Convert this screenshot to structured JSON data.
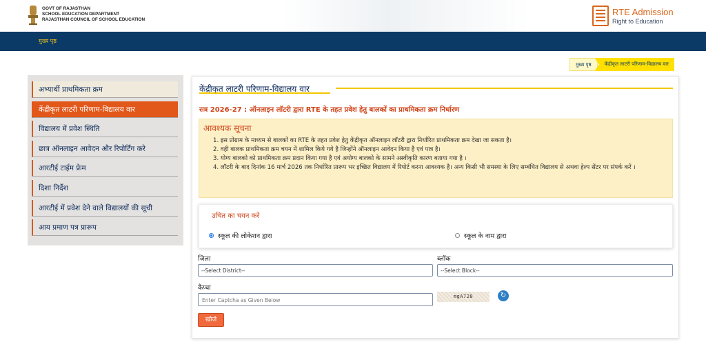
{
  "header": {
    "govt_lines": [
      "GOVT OF RAJASTHAN",
      "SCHOOL EDUCATION DEPARTMENT",
      "RAJASTHAN COUNCIL OF SCHOOL EDUCATION"
    ],
    "rte_title": "RTE Admission",
    "rte_subtitle": "Right to Education"
  },
  "nav": {
    "home": "मुख्य पृष्ठ"
  },
  "breadcrumb": {
    "home": "मुख्य पृष्ठ",
    "current": "केंद्रीकृत लाटरी परिणाम-विद्यालय वार"
  },
  "sidebar": {
    "items": [
      {
        "label": "अभ्यार्थी प्राथमिकता क्रम"
      },
      {
        "label": "केंद्रीकृत लाटरी परिणाम-विद्यालय वार"
      },
      {
        "label": "विद्यालय में प्रवेश स्थिति"
      },
      {
        "label": "छात्र ऑनलाइन आवेदन और रिपोर्टिंग करे"
      },
      {
        "label": "आरटीई टाईम फ्रेम"
      },
      {
        "label": "दिशा निर्देश"
      },
      {
        "label": "आरटीई में प्रवेश देने वाले विद्यालयों की सूची"
      },
      {
        "label": "आय प्रमाण पत्र प्रारूप"
      }
    ]
  },
  "main": {
    "title": "केंद्रीकृत लाटरी परिणाम-विद्यालय वार",
    "session": "सत्र 2026-27 : ऑनलाइन लॉटरी द्वारा RTE के तहत प्रवेश हेतु बालकों का प्राथमिकता क्रम निर्धारण",
    "notice": {
      "title": "आवश्यक सूचना",
      "items": [
        "1. इस प्रोग्राम के माध्यम से बालकों का RTE के तहत प्रवेश हेतु केंद्रीकृत ऑनलाइन लॉटरी द्वारा निर्धारित प्राथमिकता क्रम देखा जा सकता है।",
        "2. वही बालक प्राथमिकता क्रम चयन में शामिल किये गये है जिन्होंने ऑनलाइन आवेदन किया है एवं पात्र है।",
        "3. योग्य बालको को प्राथमिकता क्रम प्रदान किया गया है एवं अयोग्य बालको के सामने अस्वीकृति कारण बताया गया है ।",
        "4. लॉटरी के बाद दिनांक 16 मार्च 2026 तक निर्धारित प्रारूप भर इच्छित विद्यालय में रिपोर्ट करना आवश्यक है। अन्य किसी भी समस्या के लिए सम्बंधित विद्यालय से अथवा हेल्प सेंटर पर संपर्क करें ।"
      ]
    },
    "choose": {
      "title": "उचित का चयन करें",
      "option_location": "स्कूल की लोकेशन द्वारा",
      "option_name": "स्कूल के नाम द्वारा",
      "selected": "location"
    },
    "form": {
      "district_label": "जिला",
      "district_value": "--Select District--",
      "block_label": "ब्लॉक",
      "block_value": "--Select Block--",
      "captcha_label": "कैप्चा",
      "captcha_placeholder": "Enter Captcha as Given Below",
      "captcha_text": "mgA728",
      "search_label": "खोजे"
    }
  },
  "colors": {
    "nav": "#0b3a66",
    "accent": "#e2571a",
    "notice_bg": "#fdf0c6",
    "brand": "#d9671c"
  }
}
